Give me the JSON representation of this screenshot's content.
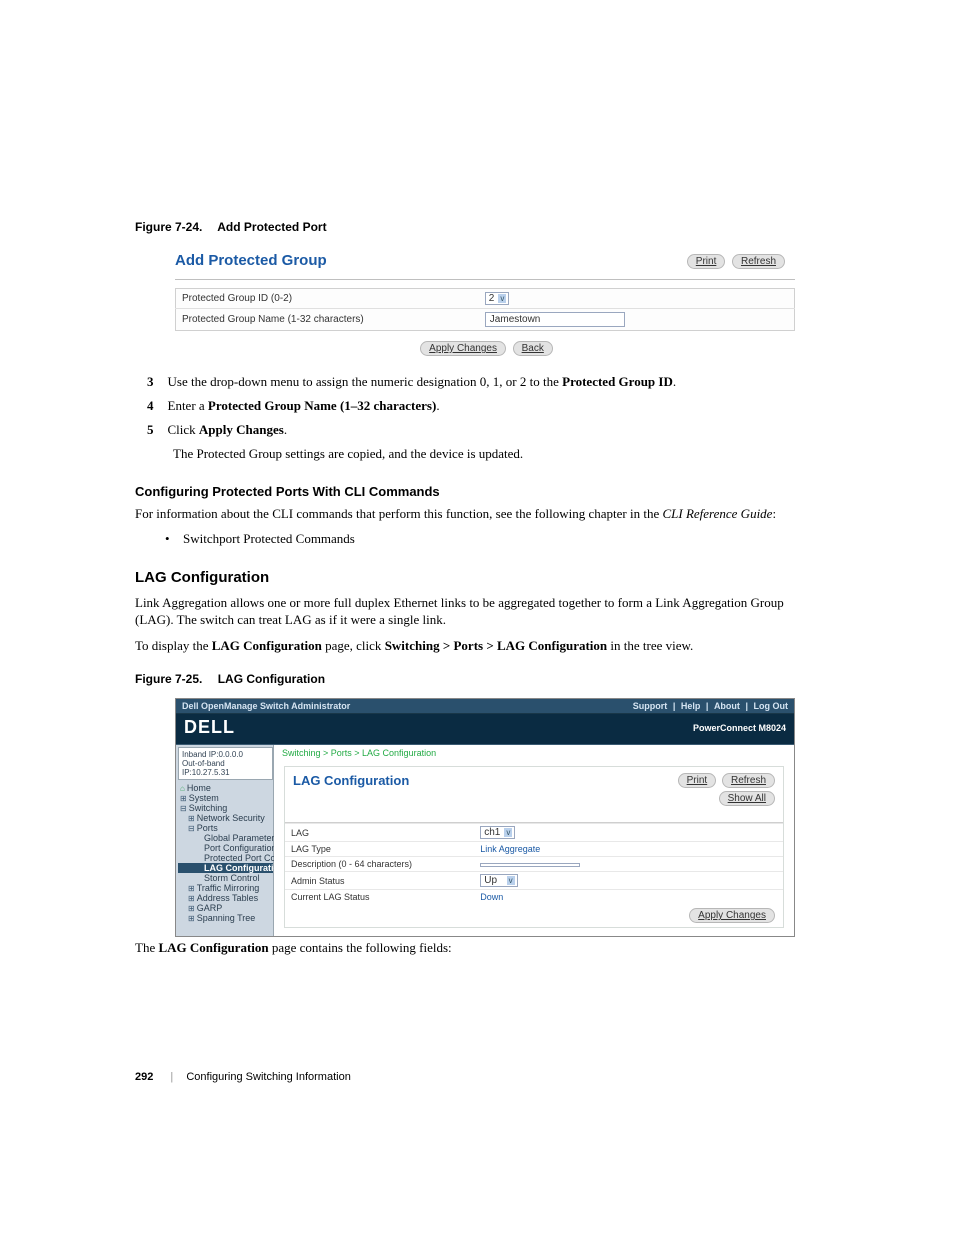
{
  "fig724": {
    "caption_num": "Figure 7-24.",
    "caption_title": "Add Protected Port",
    "panel_title": "Add Protected Group",
    "btn_print": "Print",
    "btn_refresh": "Refresh",
    "row1_label": "Protected Group ID (0-2)",
    "row1_value": "2",
    "row2_label": "Protected Group Name (1-32 characters)",
    "row2_value": "Jamestown",
    "btn_apply": "Apply Changes",
    "btn_back": "Back"
  },
  "steps": {
    "s3_num": "3",
    "s3_text_a": "Use the drop-down menu to assign the numeric designation 0, 1, or 2 to the ",
    "s3_text_b": "Protected Group ID",
    "s3_text_c": ".",
    "s4_num": "4",
    "s4_text_a": "Enter a ",
    "s4_text_b": "Protected Group Name (1–32 characters)",
    "s4_text_c": ".",
    "s5_num": "5",
    "s5_text_a": "Click ",
    "s5_text_b": "Apply Changes",
    "s5_text_c": ".",
    "s5_result": "The Protected Group settings are copied, and the device is updated."
  },
  "cli": {
    "heading": "Configuring Protected Ports With CLI Commands",
    "para_a": "For information about the CLI commands that perform this function, see the following chapter in the ",
    "para_b": "CLI Reference Guide",
    "para_c": ":",
    "bullet": "Switchport Protected Commands"
  },
  "lag": {
    "heading": "LAG Configuration",
    "para1": "Link Aggregation allows one or more full duplex Ethernet links to be aggregated together to form a Link Aggregation Group (LAG). The switch can treat LAG as if it were a single link.",
    "para2_a": "To display the ",
    "para2_b": "LAG Configuration",
    "para2_c": " page, click ",
    "para2_d": "Switching > Ports > LAG Configuration",
    "para2_e": " in the tree view."
  },
  "fig725": {
    "caption_num": "Figure 7-25.",
    "caption_title": "LAG Configuration",
    "appbar_title": "Dell OpenManage Switch Administrator",
    "link_support": "Support",
    "link_help": "Help",
    "link_about": "About",
    "link_logout": "Log Out",
    "brand": "DELL",
    "product": "PowerConnect M8024",
    "ip1": "Inband IP:0.0.0.0",
    "ip2": "Out-of-band IP:10.27.5.31",
    "tree": {
      "home": "Home",
      "system": "System",
      "switching": "Switching",
      "netsec": "Network Security",
      "ports": "Ports",
      "global": "Global Parameters",
      "portconf": "Port Configuration",
      "protport": "Protected Port Conf",
      "lagconf": "LAG Configuration",
      "storm": "Storm Control",
      "traffic": "Traffic Mirroring",
      "addr": "Address Tables",
      "garp": "GARP",
      "span": "Spanning Tree"
    },
    "breadcrumb": "Switching > Ports > LAG Configuration",
    "panel_title": "LAG Configuration",
    "btn_print": "Print",
    "btn_refresh": "Refresh",
    "btn_showall": "Show All",
    "row_lag_label": "LAG",
    "row_lag_value": "ch1",
    "row_type_label": "LAG Type",
    "row_type_value": "Link Aggregate",
    "row_desc_label": "Description (0 - 64 characters)",
    "row_desc_value": "",
    "row_admin_label": "Admin Status",
    "row_admin_value": "Up",
    "row_cur_label": "Current LAG Status",
    "row_cur_value": "Down",
    "btn_apply": "Apply Changes",
    "after_a": "The ",
    "after_b": "LAG Configuration",
    "after_c": " page contains the following fields:"
  },
  "footer": {
    "page": "292",
    "chapter": "Configuring Switching Information"
  }
}
